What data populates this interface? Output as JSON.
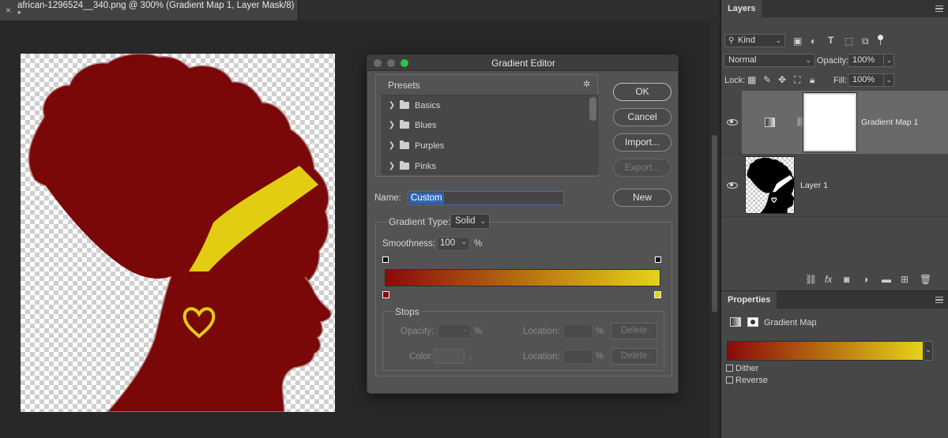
{
  "document": {
    "tab_title": "african-1296524__340.png @ 300% (Gradient Map 1, Layer Mask/8) *",
    "close_glyph": "×"
  },
  "dialog": {
    "title": "Gradient Editor",
    "presets": {
      "label": "Presets",
      "items": [
        "Basics",
        "Blues",
        "Purples",
        "Pinks"
      ]
    },
    "buttons": {
      "ok": "OK",
      "cancel": "Cancel",
      "import": "Import...",
      "export": "Export...",
      "new": "New"
    },
    "name_label": "Name:",
    "name_value": "Custom",
    "gradient_type_label": "Gradient Type:",
    "gradient_type_value": "Solid",
    "smoothness_label": "Smoothness:",
    "smoothness_value": "100",
    "smoothness_unit": "%",
    "gradient_start_color": "#8a0a0a",
    "gradient_end_color": "#e5d21a",
    "stops": {
      "label": "Stops",
      "opacity_label": "Opacity:",
      "location_label": "Location:",
      "color_label": "Color:",
      "percent": "%",
      "delete_label": "Delete"
    }
  },
  "layers_panel": {
    "tab": "Layers",
    "filter_kind": "Kind",
    "blend_mode": "Normal",
    "opacity_label": "Opacity:",
    "opacity_value": "100%",
    "lock_label": "Lock:",
    "fill_label": "Fill:",
    "fill_value": "100%",
    "layers": [
      {
        "name": "Gradient Map 1"
      },
      {
        "name": "Layer 1"
      }
    ]
  },
  "properties_panel": {
    "tab": "Properties",
    "title": "Gradient Map",
    "dither_label": "Dither",
    "reverse_label": "Reverse"
  },
  "colors": {
    "maroon": "#7a0808",
    "yellow": "#e3cd12"
  }
}
